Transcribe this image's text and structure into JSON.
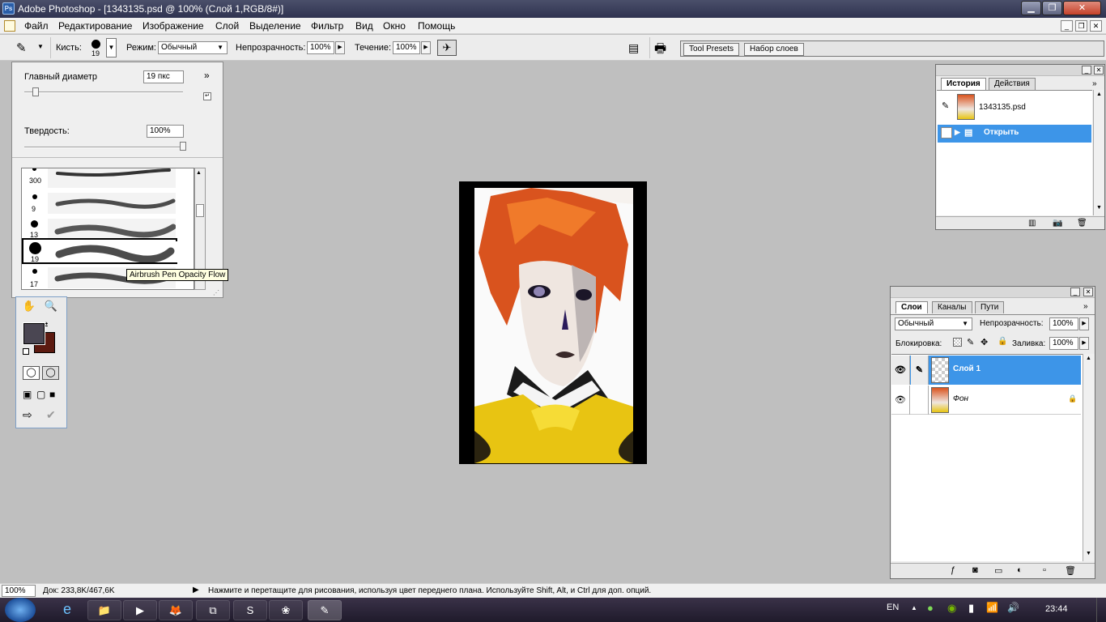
{
  "window": {
    "title": "Adobe Photoshop - [1343135.psd @ 100% (Слой 1,RGB/8#)]"
  },
  "menu": [
    "Файл",
    "Редактирование",
    "Изображение",
    "Слой",
    "Выделение",
    "Фильтр",
    "Вид",
    "Окно",
    "Помощь"
  ],
  "options": {
    "brush_label": "Кисть:",
    "brush_size": "19",
    "mode_label": "Режим:",
    "mode_value": "Обычный",
    "opacity_label": "Непрозрачность:",
    "opacity_value": "100%",
    "flow_label": "Течение:",
    "flow_value": "100%",
    "tab_tool_presets": "Tool Presets",
    "tab_layer_comps": "Набор слоев"
  },
  "brush_panel": {
    "diameter_label": "Главный диаметр",
    "diameter_value": "19 пкс",
    "hardness_label": "Твердость:",
    "hardness_value": "100%",
    "diameter_level": 0.05,
    "hardness_level": 1.0,
    "brushes": [
      {
        "size": "300"
      },
      {
        "size": "9"
      },
      {
        "size": "13"
      },
      {
        "size": "19"
      },
      {
        "size": "17"
      }
    ],
    "tooltip": "Airbrush Pen Opacity Flow"
  },
  "colors": {
    "foreground": "#4a4652",
    "background": "#5c1a10",
    "selection": "#3d95e8"
  },
  "history_panel": {
    "tabs": [
      "История",
      "Действия"
    ],
    "snapshot": "1343135.psd",
    "items": [
      "Открыть"
    ]
  },
  "layers_panel": {
    "tabs": [
      "Слои",
      "Каналы",
      "Пути"
    ],
    "blend_mode": "Обычный",
    "opacity_label": "Непрозрачность:",
    "opacity_value": "100%",
    "lock_label": "Блокировка:",
    "fill_label": "Заливка:",
    "fill_value": "100%",
    "layers": [
      {
        "name": "Слой 1"
      },
      {
        "name": "Фон"
      }
    ]
  },
  "status": {
    "zoom": "100%",
    "doc": "Док: 233,8K/467,6K",
    "hint": "Нажмите и перетащите для рисования, используя цвет переднего плана. Используйте Shift, Alt, и Ctrl для доп. опций."
  },
  "taskbar": {
    "lang": "EN",
    "time": "23:44"
  }
}
